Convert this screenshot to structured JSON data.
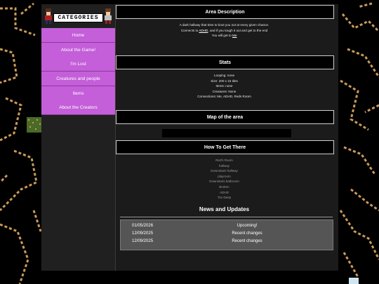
{
  "sidebar": {
    "header": "CATEGORIES",
    "items": [
      {
        "label": "Home"
      },
      {
        "label": "About the Game!"
      },
      {
        "label": "I'm Lost"
      },
      {
        "label": "Creatures and people"
      },
      {
        "label": "Items"
      },
      {
        "label": "About the Creators"
      }
    ]
  },
  "area": {
    "heading": "Area Description",
    "line1": "A dark hallway that tries to boot you out at every given chance.",
    "line2_pre": "Connects to ",
    "line2_link": "ADHD",
    "line2_post": ", and if you tough it out and get to the end",
    "line3_pre": "You will get to ",
    "line3_link": "Me"
  },
  "stats": {
    "heading": "Stats",
    "lines": [
      "Looping: none",
      "Size: 200 x 15 tiles",
      "Items: none",
      "Creatures: None",
      "Connections: Me, ADHD, Reds Room"
    ]
  },
  "map": {
    "heading": "Map of the area"
  },
  "howto": {
    "heading": "How To Get There",
    "steps": [
      "Red's Room",
      "hallway",
      "Downstairs hallway",
      "playroom",
      "Downstairs bathroom",
      "Broken",
      "ADHD",
      "Too Deep"
    ]
  },
  "news": {
    "title": "News and Updates",
    "rows": [
      {
        "date": "01/05/2026",
        "text": "Upcoming!"
      },
      {
        "date": "12/09/2025",
        "text": "Recent changes"
      },
      {
        "date": "12/09/2025",
        "text": "Recent changes"
      }
    ]
  },
  "colors": {
    "nav": "#c45ed9",
    "background": "#000000",
    "accent_lines": "#c89a5a"
  }
}
